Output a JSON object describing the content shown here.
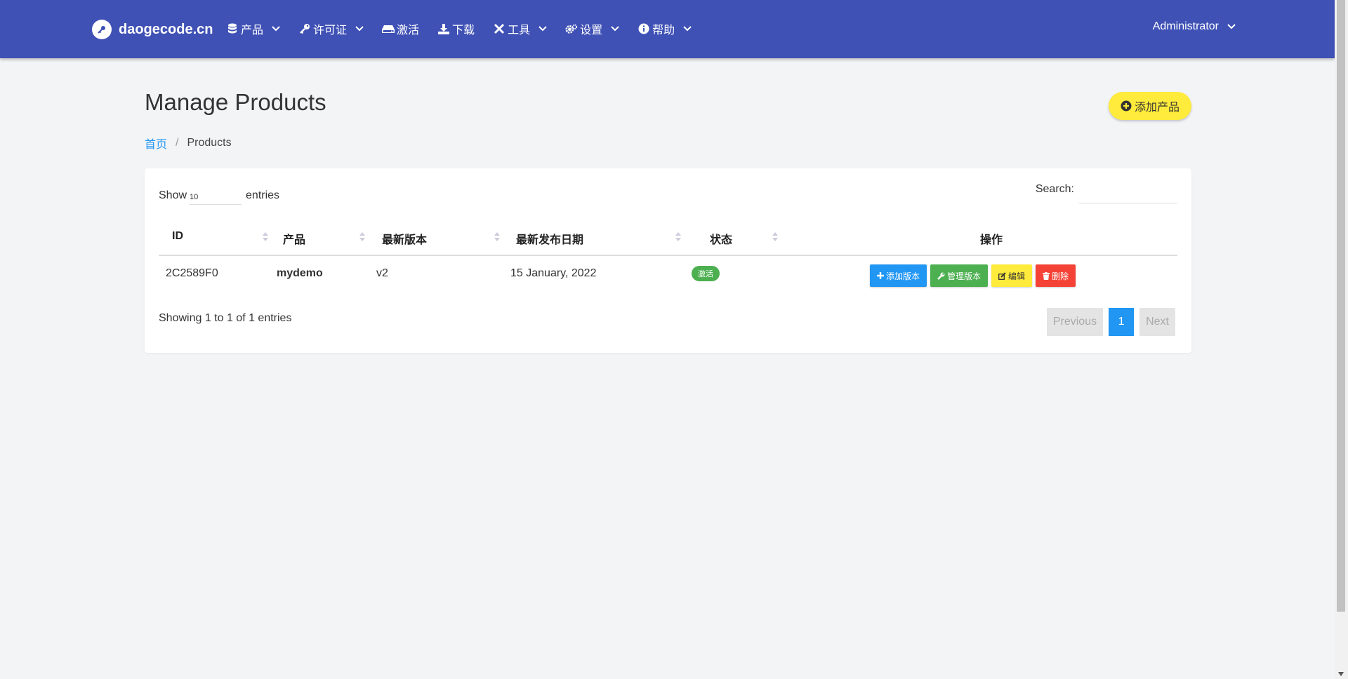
{
  "nav": {
    "brand": "daogecode.cn",
    "items": [
      {
        "label": "产品",
        "icon": "database-icon",
        "dropdown": true
      },
      {
        "label": "许可证",
        "icon": "key-icon",
        "dropdown": true
      },
      {
        "label": "激活",
        "icon": "hdd-icon",
        "dropdown": false
      },
      {
        "label": "下载",
        "icon": "download-icon",
        "dropdown": false
      },
      {
        "label": "工具",
        "icon": "tools-icon",
        "dropdown": true
      },
      {
        "label": "设置",
        "icon": "cogs-icon",
        "dropdown": true
      },
      {
        "label": "帮助",
        "icon": "info-circle-icon",
        "dropdown": true
      }
    ],
    "user": "Administrator"
  },
  "page": {
    "title": "Manage Products",
    "add_button": "添加产品",
    "breadcrumb": {
      "home": "首页",
      "current": "Products"
    }
  },
  "table_controls": {
    "show_label": "Show",
    "length_value": "10",
    "entries_label": "entries",
    "search_label": "Search:"
  },
  "table": {
    "headers": [
      "ID",
      "产品",
      "最新版本",
      "最新发布日期",
      "状态",
      "操作"
    ],
    "rows": [
      {
        "id": "2C2589F0",
        "product": "mydemo",
        "version": "v2",
        "date": "15 January, 2022",
        "status": "激活",
        "actions": {
          "add_version": "添加版本",
          "manage_versions": "管理版本",
          "edit": "编辑",
          "delete": "删除"
        }
      }
    ]
  },
  "footer": {
    "info": "Showing 1 to 1 of 1 entries",
    "previous": "Previous",
    "page": "1",
    "next": "Next"
  },
  "colors": {
    "navbar": "#3f51b5",
    "primary": "#2196f3",
    "success": "#4caf50",
    "warning": "#ffeb3b",
    "danger": "#f44336"
  }
}
